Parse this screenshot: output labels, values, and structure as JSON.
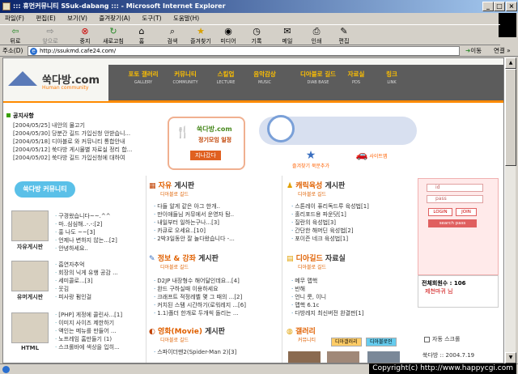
{
  "window": {
    "title": "::: 휴먼커뮤니티 SSuk-dabang ::: - Microsoft Internet Explorer"
  },
  "menu": [
    "파일(F)",
    "편집(E)",
    "보기(V)",
    "즐겨찾기(A)",
    "도구(T)",
    "도움말(H)"
  ],
  "toolbar": {
    "back": "뒤로",
    "forward": "앞으로",
    "stop": "중지",
    "refresh": "새로고침",
    "home": "홈",
    "search": "검색",
    "favorites": "즐겨찾기",
    "media": "미디어",
    "history": "기록",
    "mail": "메일",
    "print": "인쇄",
    "edit": "편집"
  },
  "address": {
    "label": "주소(D)",
    "url": "http://ssukmd.cafe24.com/",
    "go": "이동",
    "links": "연결 »"
  },
  "site": {
    "logo": "쑥다방.com",
    "logo_sub": "Human community",
    "nav": [
      {
        "k": "포토 갤러리",
        "e": "GALLERY"
      },
      {
        "k": "커뮤니티",
        "e": "COMMUNITY"
      },
      {
        "k": "스킬업",
        "e": "LECTURE"
      },
      {
        "k": "음악감상",
        "e": "MUSIC"
      },
      {
        "k": "디아블로 길드",
        "e": "DIAB BASE"
      },
      {
        "k": "자료실",
        "e": "PDS"
      },
      {
        "k": "링크",
        "e": "LINK"
      }
    ],
    "notice": {
      "title": "공지사항",
      "items": [
        "[2004/05/25] 내안의 물고기",
        "[2004/05/30] 당분간 길드 가입신청 안받습니...",
        "[2004/05/18] 디아블로 와 커뮤니티 통합안내",
        "[2004/05/12] 쑥다방 게시물별 자료실 정리 합...",
        "[2004/05/02] 쑥다방 길드 가입신청에 대하여"
      ]
    },
    "promo": {
      "line1": "쑥다방.com",
      "line2": "정기모임 일정",
      "line3": "지나갔다"
    },
    "quick": {
      "fav": "즐겨찾기 북문추가",
      "mail": "사이트맵"
    },
    "left": {
      "badge": "쑥다방 커뮤니티",
      "sections": [
        {
          "label": "자유게시판",
          "items": [
            "구경왔습니다~~.^^",
            "마..심심해..-.-:[2]",
            "홍 나도 ~~[3]",
            "언제나 변하지 않는...[2]",
            "안녕하세요.."
          ]
        },
        {
          "label": "유머게시판",
          "items": [
            "흡연자추억",
            "회장의 닉게 유행 공감 ...",
            "세미콜로...[3]",
            "웃김",
            "피사랑 펌인걸"
          ]
        },
        {
          "label": "HTML",
          "items": [
            "[PHP] 게정에 콜린사...[1]",
            "이미지 사이즈 제한하기",
            "액인는 메뉴를 만들어 ...",
            "노프레임 홈만들기 (1)",
            "스크롤바에 색상을 입히..."
          ]
        }
      ]
    },
    "boards": [
      {
        "title": "자유",
        "title2": "게시판",
        "sub": "디아블로 길드",
        "items": [
          "다들 알게 같은 아그 한개..",
          "만이애들님 커뮤에서 운영자 탐..",
          "내일부터 일하는구나...[3]",
          "카큐로 오세요..[10]",
          "2박3일동안 잘 놀다왔습니다 -..."
        ]
      },
      {
        "title": "캐릭육성",
        "title2": "게시판",
        "sub": "디아블로 길드",
        "items": [
          "스톤레이 퓨리독드루 육성법[1]",
          "홀리포드용 파운닷[1]",
          "질란의 육성법[3]",
          "간단한 해머딘 육성법[2]",
          "포이즌 네크 육성법[1]"
        ]
      },
      {
        "title": "정보 & 강좌",
        "title2": "게시판",
        "sub": "디아블로 길드",
        "items": [
          "D2JP 내장형수 해어달인데요...[4]",
          "완드 구하실때 이용하세요",
          "크래프트 적정레벨 몇 그 때의 ...[2]",
          "커치된 스탬 시간하기(로워레지 ...[6]",
          "1.1)폴더 한개로 두개씩 돌리는 ..."
        ]
      },
      {
        "title": "디아길드",
        "title2": "자료실",
        "sub": "디아블로 길드",
        "items": [
          "메무 맵핵",
          "반해",
          "언니 룻, 이니",
          "맵핵 6.1c",
          "다방레지 최신버전 완결판[1]"
        ]
      },
      {
        "title": "영화(Movie)",
        "title2": "게시판",
        "sub": "디아블로 길드",
        "items": [
          "스파이더맨2(Spider-Man 2)[3]"
        ]
      },
      {
        "title": "갤러리",
        "title2": "",
        "sub": "커뮤니티",
        "items": []
      }
    ],
    "gallery_tabs": [
      "디아갤러리",
      "디아블로인"
    ],
    "login": {
      "id": "id",
      "pass": "pass",
      "login": "LOGIN",
      "join": "JOIN",
      "search": "search pass"
    },
    "stats": {
      "line1": "전체회원수 : 106",
      "line2": "제천마귀 님"
    },
    "autoscroll": "자동 스크롤",
    "bottom_user": "쑥다방 ::    2004.7.19"
  },
  "status": {
    "copyright": "Copyright(c) http://www.happycgi.com"
  }
}
